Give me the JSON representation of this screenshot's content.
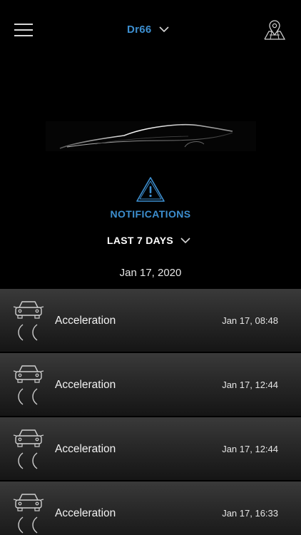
{
  "header": {
    "vehicle_name": "Dr66",
    "menu_icon": "hamburger-menu-icon",
    "map_icon": "map-pin-icon",
    "dropdown_icon": "chevron-down-icon"
  },
  "section": {
    "icon": "warning-triangle-icon",
    "title": "NOTIFICATIONS"
  },
  "filter": {
    "period_label": "LAST 7 DAYS"
  },
  "list": {
    "date_heading": "Jan 17, 2020",
    "items": [
      {
        "title": "Acceleration",
        "time": "Jan 17, 08:48",
        "icon": "car-acceleration-icon"
      },
      {
        "title": "Acceleration",
        "time": "Jan 17, 12:44",
        "icon": "car-acceleration-icon"
      },
      {
        "title": "Acceleration",
        "time": "Jan 17, 12:44",
        "icon": "car-acceleration-icon"
      },
      {
        "title": "Acceleration",
        "time": "Jan 17, 16:33",
        "icon": "car-acceleration-icon"
      }
    ]
  },
  "colors": {
    "accent": "#3d8fd0",
    "background": "#000000",
    "row_top": "#3a3a3a",
    "row_bottom": "#151515"
  }
}
